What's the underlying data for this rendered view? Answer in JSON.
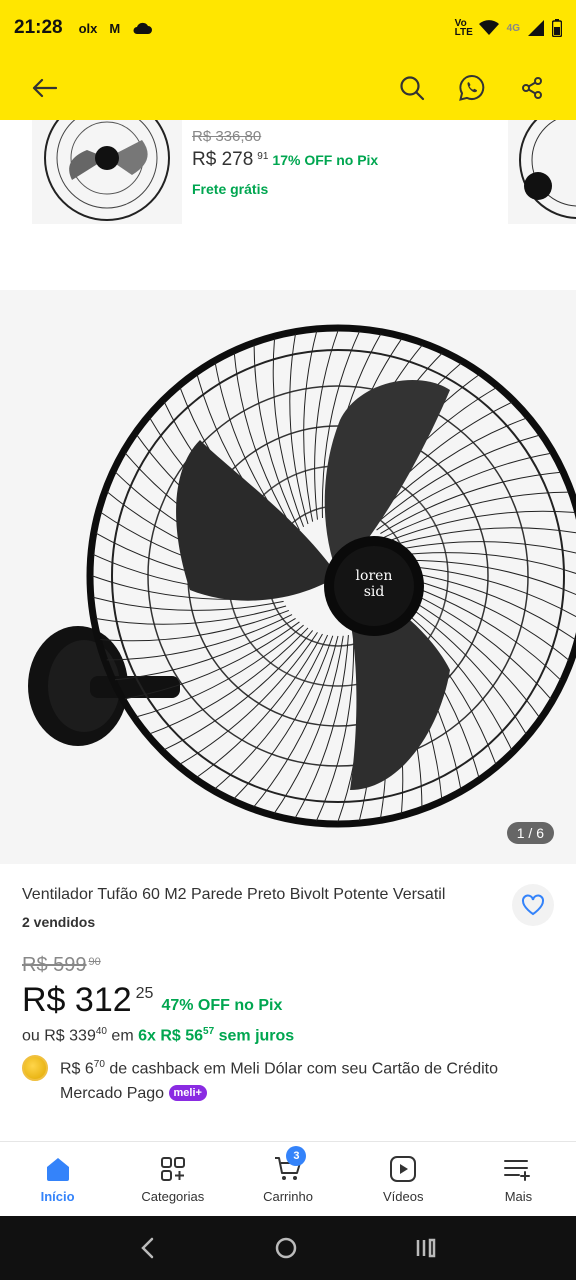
{
  "status_bar": {
    "time": "21:28",
    "notifications": [
      "olx",
      "M"
    ],
    "volte": "Vo LTE",
    "network": "4G"
  },
  "related": {
    "old_price": "R$ 336,80",
    "price_main": "R$ 278",
    "price_cents": "91",
    "off": "17% OFF no Pix",
    "shipping": "Frete grátis"
  },
  "gallery": {
    "pager": "1 / 6",
    "brand_logo_text": "loren sid"
  },
  "product": {
    "title": "Ventilador Tufão 60 M2 Parede Preto Bivolt Potente Versatil",
    "sold": "2 vendidos",
    "old_price": "R$ 599",
    "old_price_cents": "90",
    "price_main": "R$ 312",
    "price_cents": "25",
    "off": "47% OFF no Pix",
    "installments_prefix": "ou R$ 339",
    "installments_prefix_cents": "40",
    "installments_mid": " em ",
    "installments_plan": "6x R$ 56",
    "installments_plan_cents": "57",
    "installments_suffix": " sem juros",
    "cashback_prefix": "R$ 6",
    "cashback_cents": "70",
    "cashback_text": " de cashback em Meli Dólar com seu Cartão de Crédito Mercado Pago ",
    "meli_badge": "meli+"
  },
  "bottom_nav": {
    "items": [
      {
        "label": "Início",
        "icon": "home-icon"
      },
      {
        "label": "Categorias",
        "icon": "categories-icon"
      },
      {
        "label": "Carrinho",
        "icon": "cart-icon"
      },
      {
        "label": "Vídeos",
        "icon": "video-icon"
      },
      {
        "label": "Mais",
        "icon": "menu-plus-icon"
      }
    ],
    "cart_count": "3"
  },
  "colors": {
    "brand_yellow": "#ffe600",
    "accent_blue": "#3483fa",
    "green": "#00a650"
  }
}
